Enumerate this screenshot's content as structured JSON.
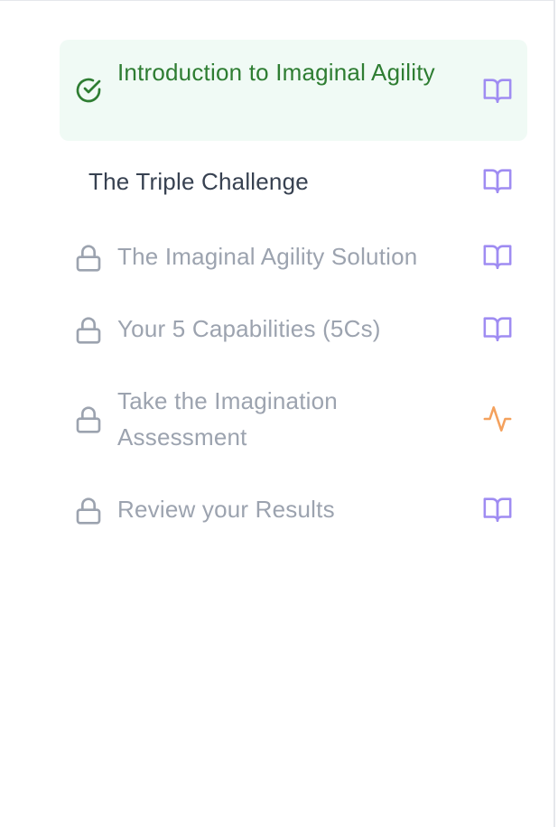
{
  "colors": {
    "completed_text": "#2e7d32",
    "completed_bg": "#f0faf5",
    "current_text": "#374151",
    "locked_text": "#9ca3af",
    "reading_icon": "#9f8cf2",
    "assessment_icon": "#f4a15d"
  },
  "lessons": [
    {
      "title": "Introduction to Imaginal Agility",
      "status": "completed",
      "status_icon": "check-circle-icon",
      "type_icon": "book-open-icon"
    },
    {
      "title": "The Triple Challenge",
      "status": "current",
      "status_icon": "",
      "type_icon": "book-open-icon"
    },
    {
      "title": "The Imaginal Agility Solution",
      "status": "locked",
      "status_icon": "lock-icon",
      "type_icon": "book-open-icon"
    },
    {
      "title": "Your 5 Capabilities (5Cs)",
      "status": "locked",
      "status_icon": "lock-icon",
      "type_icon": "book-open-icon"
    },
    {
      "title": "Take the Imagination Assessment",
      "status": "locked",
      "status_icon": "lock-icon",
      "type_icon": "activity-icon"
    },
    {
      "title": "Review your Results",
      "status": "locked",
      "status_icon": "lock-icon",
      "type_icon": "book-open-icon"
    }
  ]
}
